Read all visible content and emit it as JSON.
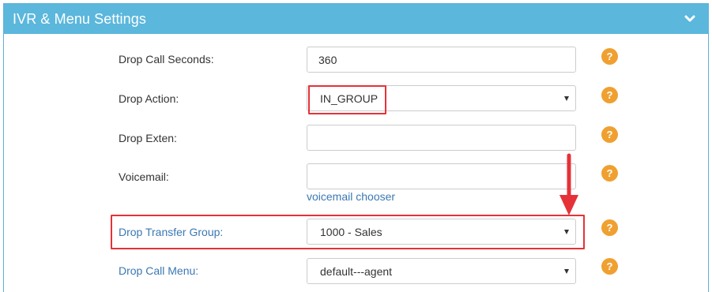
{
  "panel": {
    "title": "IVR & Menu Settings",
    "collapse_icon": "chevron-down-icon"
  },
  "fields": {
    "drop_call_seconds": {
      "label": "Drop Call Seconds:",
      "value": "360"
    },
    "drop_action": {
      "label": "Drop Action:",
      "value": "IN_GROUP"
    },
    "drop_exten": {
      "label": "Drop Exten:",
      "value": ""
    },
    "voicemail": {
      "label": "Voicemail:",
      "value": "",
      "chooser_link": "voicemail chooser"
    },
    "drop_transfer_group": {
      "label": "Drop Transfer Group:",
      "value": "1000 - Sales"
    },
    "drop_call_menu": {
      "label": "Drop Call Menu:",
      "value": "default---agent"
    }
  },
  "help": {
    "symbol": "?",
    "icon": "question-circle-icon"
  },
  "colors": {
    "header": "#5bb7dc",
    "help_badge": "#f0a030",
    "link": "#3b78b3",
    "highlight": "#e53238"
  }
}
